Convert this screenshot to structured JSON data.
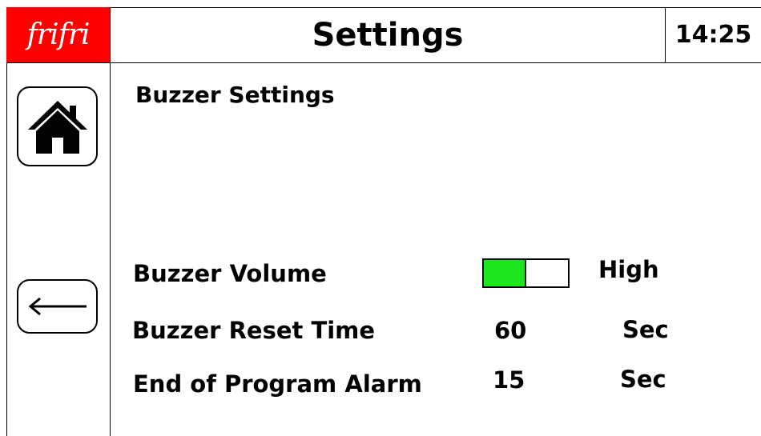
{
  "header": {
    "logo_text": "frifri",
    "title": "Settings",
    "clock": "14:25",
    "logo_color": "#ff0000"
  },
  "sidebar": {
    "home_icon": "home-icon",
    "back_icon": "arrow-left-icon"
  },
  "main": {
    "section_title": "Buzzer Settings",
    "rows": [
      {
        "label": "Buzzer Volume",
        "level_text": "High",
        "level_fraction": 0.5
      },
      {
        "label": "Buzzer Reset Time",
        "value": "60",
        "unit": "Sec"
      },
      {
        "label": "End of Program Alarm",
        "value": "15",
        "unit": "Sec"
      }
    ],
    "volume_fill_color": "#1ee61e"
  }
}
